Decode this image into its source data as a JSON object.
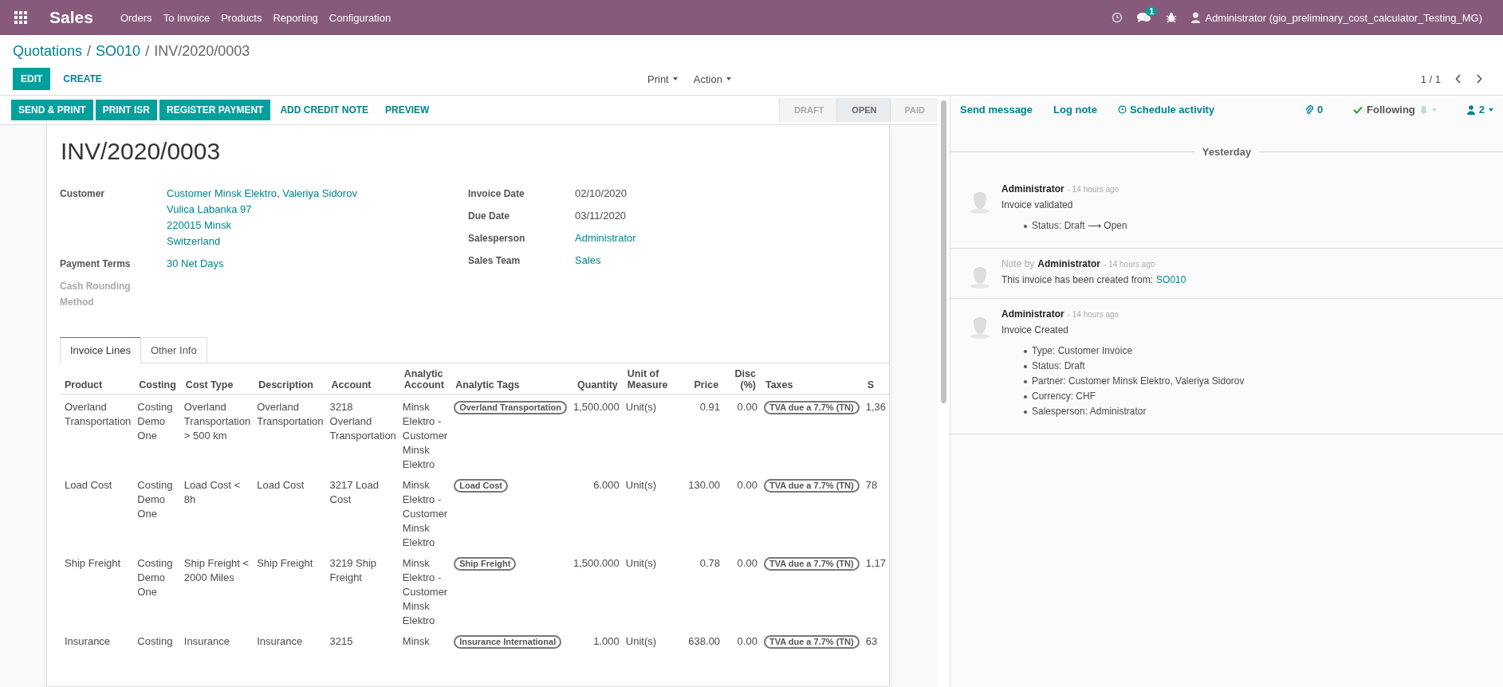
{
  "navbar": {
    "app": "Sales",
    "menu": [
      "Orders",
      "To Invoice",
      "Products",
      "Reporting",
      "Configuration"
    ],
    "chat_badge": "1",
    "user": "Administrator (gio_preliminary_cost_calculator_Testing_MG)"
  },
  "breadcrumbs": [
    "Quotations",
    "SO010",
    "INV/2020/0003"
  ],
  "breadcrumb_separator": "/",
  "main_buttons": [
    {
      "label": "EDIT",
      "kind": "primary"
    },
    {
      "label": "CREATE",
      "kind": "link"
    }
  ],
  "dropdowns": [
    "Print",
    "Action"
  ],
  "pager": "1 / 1",
  "header_buttons": [
    {
      "label": "SEND & PRINT",
      "kind": "primary"
    },
    {
      "label": "PRINT ISR",
      "kind": "primary"
    },
    {
      "label": "REGISTER PAYMENT",
      "kind": "primary"
    },
    {
      "label": "ADD CREDIT NOTE",
      "kind": "link"
    },
    {
      "label": "PREVIEW",
      "kind": "link"
    }
  ],
  "statusbar": [
    {
      "label": "DRAFT",
      "selected": false
    },
    {
      "label": "OPEN",
      "selected": true
    },
    {
      "label": "PAID",
      "selected": false
    }
  ],
  "title": "INV/2020/0003",
  "left_fields": [
    {
      "label": "Customer",
      "values": [
        "Customer Minsk Elektro, Valeriya Sidorov",
        "Vulica Labanka 97",
        "220015 Minsk",
        "Switzerland"
      ],
      "kind": "link",
      "disabled": false
    },
    {
      "label": "Payment Terms",
      "values": [
        "30 Net Days"
      ],
      "kind": "link",
      "disabled": false
    },
    {
      "label": "Cash Rounding Method",
      "disabled": true
    }
  ],
  "right_fields": [
    {
      "label": "Invoice Date",
      "values": [
        "02/10/2020"
      ],
      "kind": "text",
      "disabled": false
    },
    {
      "label": "Due Date",
      "values": [
        "03/11/2020"
      ],
      "kind": "text",
      "disabled": false
    },
    {
      "label": "Salesperson",
      "values": [
        "Administrator"
      ],
      "kind": "link",
      "disabled": false
    },
    {
      "label": "Sales Team",
      "values": [
        "Sales"
      ],
      "kind": "link",
      "disabled": false
    }
  ],
  "tabs": [
    {
      "label": "Invoice Lines",
      "selected": true
    },
    {
      "label": "Other Info",
      "selected": false
    }
  ],
  "table": {
    "columns": [
      "Product",
      "Costing",
      "Cost Type",
      "Description",
      "Account",
      "Analytic Account",
      "Analytic Tags",
      "Quantity",
      "Unit of Measure",
      "Price",
      "Disc (%)",
      "Taxes",
      "S"
    ],
    "rows": [
      [
        "Overland Transportation",
        "Costing Demo One",
        "Overland Transportation > 500 km",
        "Overland Transportation",
        "3218 Overland Transportation",
        "Minsk Elektro - Customer Minsk Elektro",
        "Overland Transportation",
        "1,500.000",
        "Unit(s)",
        "0.91",
        "0.00",
        "TVA due a 7.7% (TN)",
        "1,36"
      ],
      [
        "Load Cost",
        "Costing Demo One",
        "Load Cost < 8h",
        "Load Cost",
        "3217 Load Cost",
        "Minsk Elektro - Customer Minsk Elektro",
        "Load Cost",
        "6.000",
        "Unit(s)",
        "130.00",
        "0.00",
        "TVA due a 7.7% (TN)",
        "78"
      ],
      [
        "Ship Freight",
        "Costing Demo One",
        "Ship Freight < 2000 Miles",
        "Ship Freight",
        "3219 Ship Freight",
        "Minsk Elektro - Customer Minsk Elektro",
        "Ship Freight",
        "1,500.000",
        "Unit(s)",
        "0.78",
        "0.00",
        "TVA due a 7.7% (TN)",
        "1,17"
      ],
      [
        "Insurance",
        "Costing",
        "Insurance",
        "Insurance",
        "3215",
        "Minsk",
        "Insurance International",
        "1.000",
        "Unit(s)",
        "638.00",
        "0.00",
        "TVA due a 7.7% (TN)",
        "63"
      ]
    ]
  },
  "chatter": {
    "actions": [
      "Send message",
      "Log note",
      "Schedule activity"
    ],
    "attachments": "0",
    "following": "Following",
    "followers": "2",
    "date_separator": "Yesterday",
    "messages": [
      {
        "kind": "message",
        "author": "Administrator",
        "time": "- 14 hours ago",
        "body": "Invoice validated",
        "tracking": [
          "Status: Draft ⟶ Open"
        ]
      },
      {
        "kind": "note",
        "prefix": "Note by",
        "author": "Administrator",
        "time": "- 14 hours ago",
        "body": "This invoice has been created from:",
        "link": "SO010"
      },
      {
        "kind": "message",
        "author": "Administrator",
        "time": "- 14 hours ago",
        "body": "Invoice Created",
        "tracking": [
          "Type: Customer Invoice",
          "Status: Draft",
          "Partner: Customer Minsk Elektro, Valeriya Sidorov",
          "Currency: CHF",
          "Salesperson: Administrator"
        ]
      }
    ]
  }
}
